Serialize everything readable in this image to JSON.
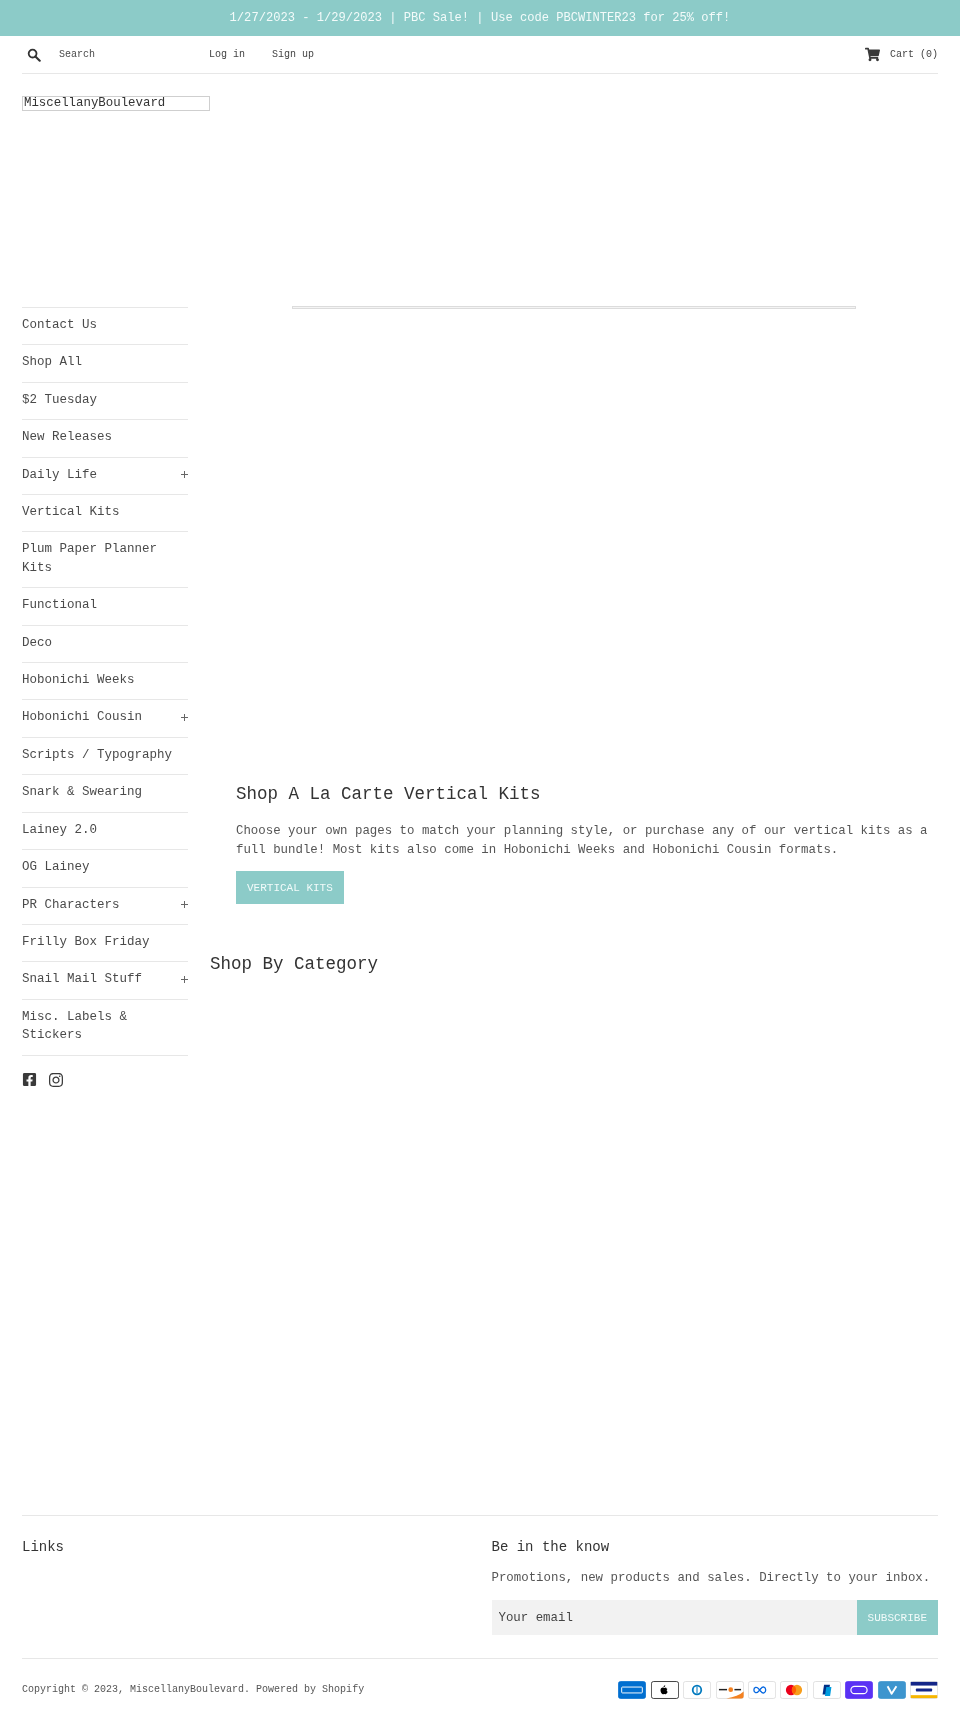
{
  "announcement": {
    "text": "1/27/2023 - 1/29/2023 | PBC Sale! | Use code PBCWINTER23 for 25% off!"
  },
  "header": {
    "search": {
      "placeholder": "Search"
    },
    "account_links": [
      "Log in",
      "Sign up"
    ],
    "cart": "Cart (0)"
  },
  "logo": {
    "text": "MiscellanyBoulevard"
  },
  "sidebar": {
    "items": [
      {
        "label": "Contact Us",
        "expandable": false
      },
      {
        "label": "Shop All",
        "expandable": false
      },
      {
        "label": "$2 Tuesday",
        "expandable": false
      },
      {
        "label": "New Releases",
        "expandable": false
      },
      {
        "label": "Daily Life",
        "expandable": true
      },
      {
        "label": "Vertical Kits",
        "expandable": false
      },
      {
        "label": "Plum Paper Planner Kits",
        "expandable": false
      },
      {
        "label": "Functional",
        "expandable": false
      },
      {
        "label": "Deco",
        "expandable": false
      },
      {
        "label": "Hobonichi Weeks",
        "expandable": false
      },
      {
        "label": "Hobonichi Cousin",
        "expandable": true
      },
      {
        "label": "Scripts / Typography",
        "expandable": false
      },
      {
        "label": "Snark & Swearing",
        "expandable": false
      },
      {
        "label": "Lainey 2.0",
        "expandable": false
      },
      {
        "label": "OG Lainey",
        "expandable": false
      },
      {
        "label": "PR Characters",
        "expandable": true
      },
      {
        "label": "Frilly Box Friday",
        "expandable": false
      },
      {
        "label": "Snail Mail Stuff",
        "expandable": true
      },
      {
        "label": "Misc. Labels & Stickers",
        "expandable": false
      }
    ]
  },
  "hero": {
    "title": "Shop A La Carte Vertical Kits",
    "text": "Choose your own pages to match your planning style, or purchase any of our vertical kits as a full bundle! Most kits also come in Hobonichi Weeks and Hobonichi Cousin formats.",
    "button": "VERTICAL KITS"
  },
  "categories": {
    "title": "Shop By Category"
  },
  "footer": {
    "links": {
      "title": "Links"
    },
    "newsletter": {
      "title": "Be in the know",
      "text": "Promotions, new products and sales. Directly to your inbox.",
      "placeholder": "Your email",
      "button": "SUBSCRIBE"
    },
    "copyright": {
      "prefix": "Copyright © 2023,",
      "store_link": "MiscellanyBoulevard",
      "separator": ".",
      "powered_link": "Powered by Shopify"
    }
  }
}
